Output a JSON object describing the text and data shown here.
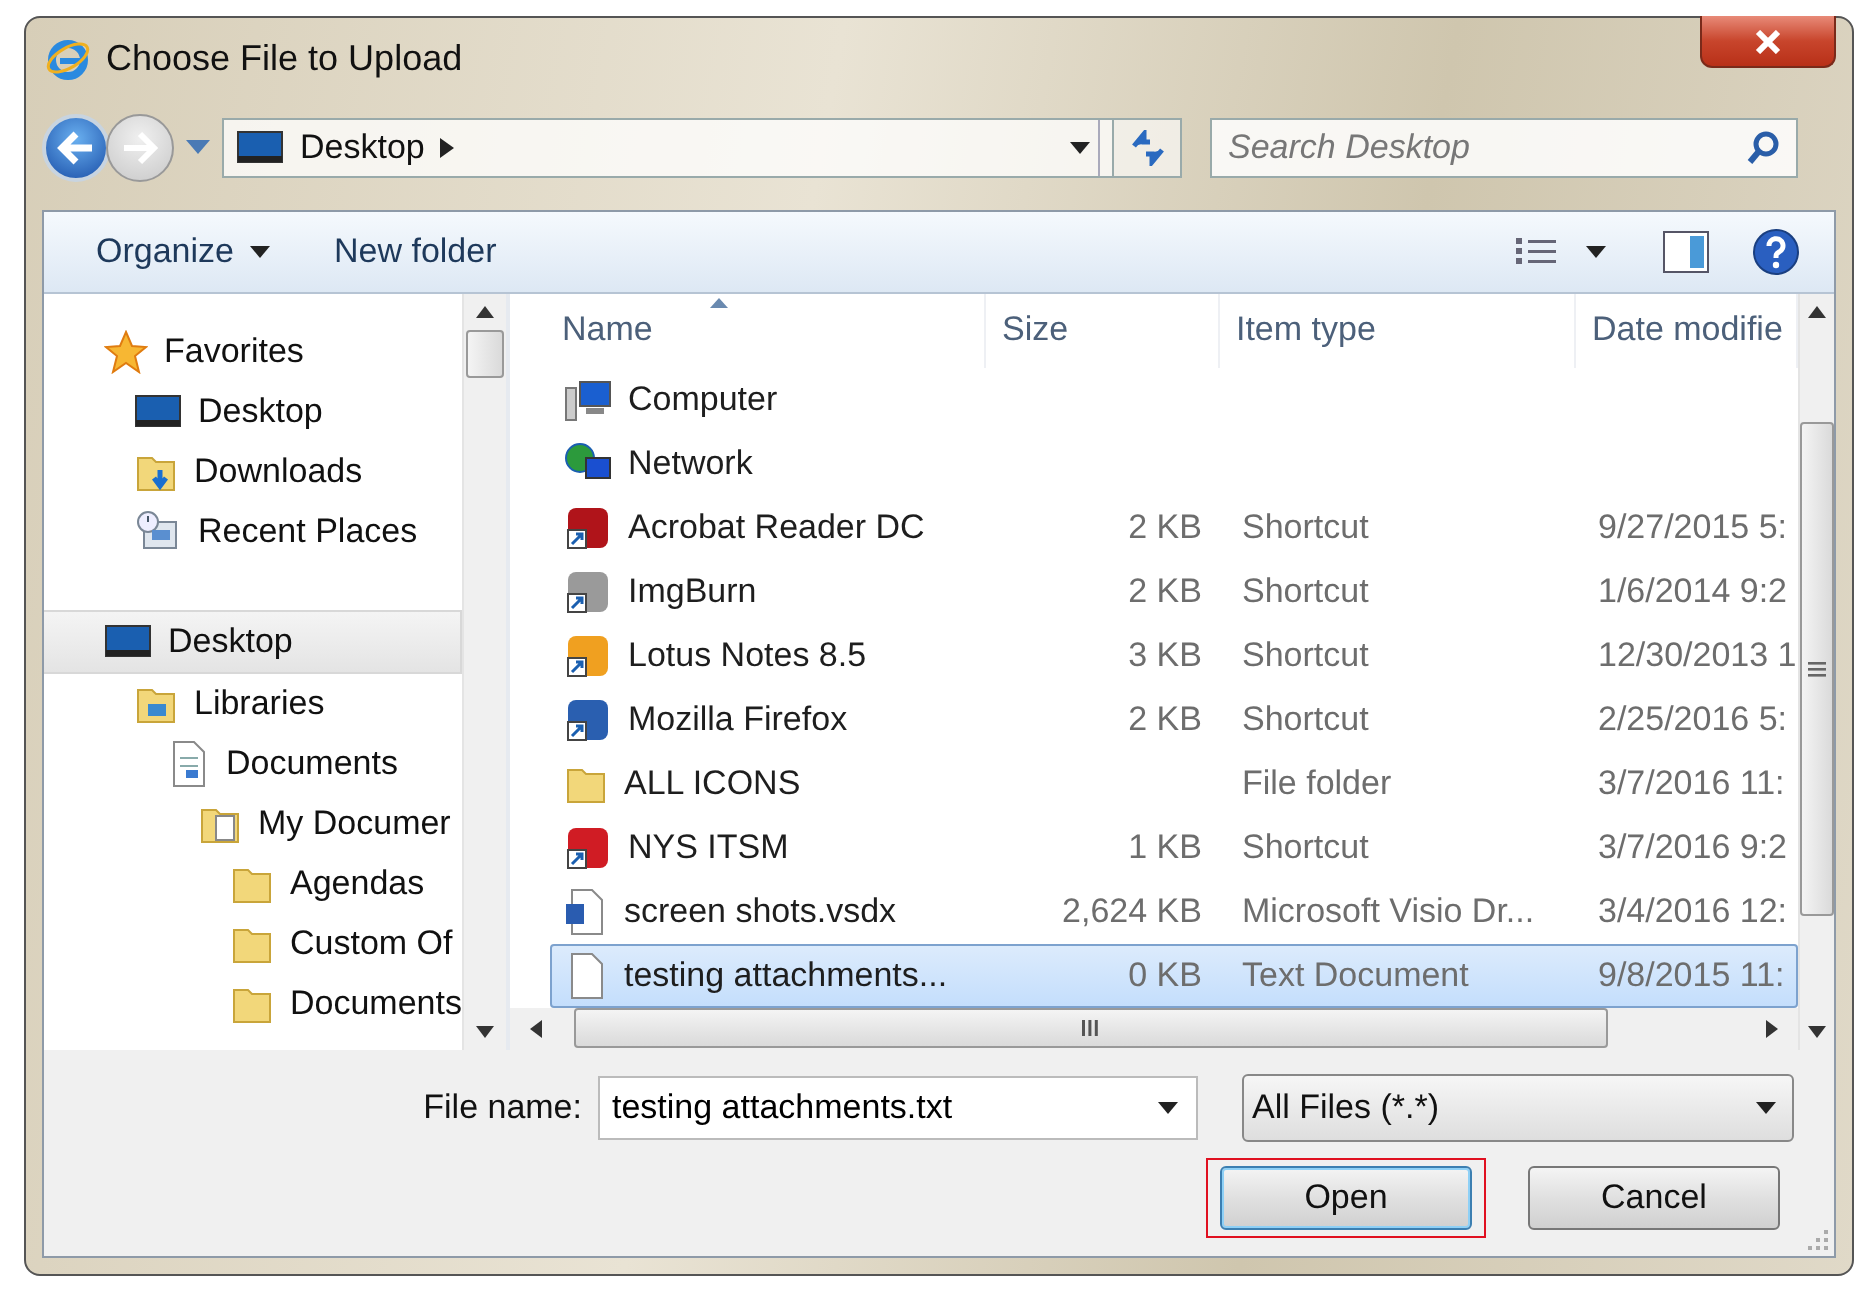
{
  "window": {
    "title": "Choose File to Upload"
  },
  "address": {
    "location": "Desktop"
  },
  "search": {
    "placeholder": "Search Desktop"
  },
  "toolbar": {
    "items": [
      "Organize",
      "New folder"
    ]
  },
  "sidebar": {
    "items": [
      {
        "label": "Favorites",
        "kind": "star",
        "selected": false,
        "children": [
          {
            "label": "Desktop",
            "kind": "desktop",
            "selected": false
          },
          {
            "label": "Downloads",
            "kind": "downloads",
            "selected": false
          },
          {
            "label": "Recent Places",
            "kind": "recent",
            "selected": false
          }
        ]
      },
      {
        "label": "Desktop",
        "kind": "desktop",
        "selected": true,
        "children": [
          {
            "label": "Libraries",
            "kind": "library",
            "selected": false,
            "children": [
              {
                "label": "Documents",
                "kind": "document",
                "selected": false,
                "children": [
                  {
                    "label": "My Documer",
                    "kind": "document-folder",
                    "selected": false,
                    "children": [
                      {
                        "label": "Agendas",
                        "kind": "folder",
                        "selected": false
                      },
                      {
                        "label": "Custom Of",
                        "kind": "folder",
                        "selected": false
                      },
                      {
                        "label": "Documents",
                        "kind": "folder",
                        "selected": false
                      }
                    ]
                  }
                ]
              }
            ]
          }
        ]
      }
    ]
  },
  "table": {
    "columns": [
      "Name",
      "Size",
      "Item type",
      "Date modifie"
    ],
    "rows": [
      {
        "name": "Computer",
        "size": "",
        "type": "",
        "date": "",
        "kind": "computer",
        "selected": false
      },
      {
        "name": "Network",
        "size": "",
        "type": "",
        "date": "",
        "kind": "network",
        "selected": false
      },
      {
        "name": "Acrobat Reader DC",
        "size": "2 KB",
        "type": "Shortcut",
        "date": "9/27/2015 5:",
        "kind": "shortcut",
        "color": "#b0141a",
        "selected": false
      },
      {
        "name": "ImgBurn",
        "size": "2 KB",
        "type": "Shortcut",
        "date": "1/6/2014 9:2",
        "kind": "shortcut",
        "color": "#9a9a9a",
        "selected": false
      },
      {
        "name": "Lotus Notes 8.5",
        "size": "3 KB",
        "type": "Shortcut",
        "date": "12/30/2013 1",
        "kind": "shortcut",
        "color": "#f0a020",
        "selected": false
      },
      {
        "name": "Mozilla Firefox",
        "size": "2 KB",
        "type": "Shortcut",
        "date": "2/25/2016 5:",
        "kind": "shortcut",
        "color": "#2a5fb0",
        "selected": false
      },
      {
        "name": "ALL ICONS",
        "size": "",
        "type": "File folder",
        "date": "3/7/2016 11:",
        "kind": "folder",
        "selected": false
      },
      {
        "name": "NYS ITSM",
        "size": "1 KB",
        "type": "Shortcut",
        "date": "3/7/2016 9:2",
        "kind": "shortcut",
        "color": "#d01c24",
        "selected": false
      },
      {
        "name": "screen shots.vsdx",
        "size": "2,624 KB",
        "type": "Microsoft Visio Dr...",
        "date": "3/4/2016 12:",
        "kind": "visio",
        "selected": false
      },
      {
        "name": "testing attachments...",
        "size": "0 KB",
        "type": "Text Document",
        "date": "9/8/2015 11:",
        "kind": "text",
        "selected": true
      }
    ]
  },
  "file_name": {
    "label": "File name:",
    "value": "testing attachments.txt"
  },
  "filter": {
    "value": "All Files (*.*)"
  },
  "buttons": [
    {
      "label": "Open",
      "highlighted": true
    },
    {
      "label": "Cancel",
      "highlighted": false
    }
  ]
}
